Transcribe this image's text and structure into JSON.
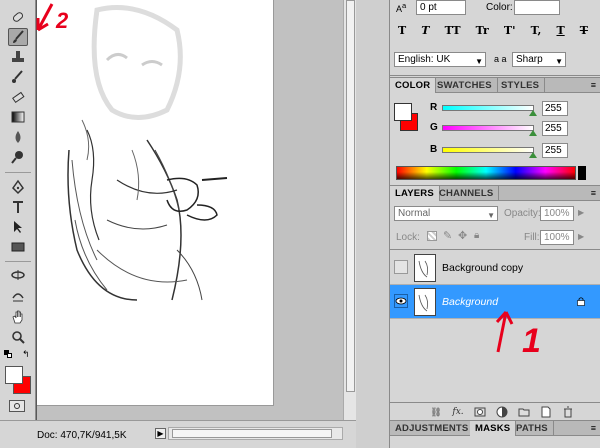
{
  "status_bar": {
    "doc_info": "Doc: 470,7K/941,5K",
    "arrow": "▶"
  },
  "character_panel": {
    "tracking_value": "0 pt",
    "color_label": "Color:",
    "typo_buttons": [
      "T",
      "T",
      "TT",
      "Tr",
      "T'",
      "T,",
      "T",
      "T"
    ],
    "language": "English: UK",
    "antialias_label": "a a",
    "antialias": "Sharp"
  },
  "color_panel": {
    "tabs": [
      "COLOR",
      "SWATCHES",
      "STYLES"
    ],
    "active_tab": "COLOR",
    "foreground_color": "#ffffff",
    "background_color": "#ff0000",
    "channels": [
      {
        "label": "R",
        "value": "255"
      },
      {
        "label": "G",
        "value": "255"
      },
      {
        "label": "B",
        "value": "255"
      }
    ]
  },
  "layers_panel": {
    "tabs": [
      "LAYERS",
      "CHANNELS"
    ],
    "active_tab": "LAYERS",
    "blend_mode": "Normal",
    "opacity_label": "Opacity:",
    "opacity_value": "100%",
    "lock_label": "Lock:",
    "fill_label": "Fill:",
    "fill_value": "100%",
    "layers": [
      {
        "name": "Background copy",
        "visible": false,
        "selected": false,
        "locked": false
      },
      {
        "name": "Background",
        "visible": true,
        "selected": true,
        "locked": true
      }
    ],
    "footer_icons": [
      "link-icon",
      "fx-icon",
      "mask-icon",
      "adjustment-icon",
      "folder-icon",
      "new-layer-icon",
      "trash-icon"
    ],
    "footer_fx": "fx."
  },
  "bottom_tabs": {
    "tabs": [
      "ADJUSTMENTS",
      "MASKS",
      "PATHS"
    ],
    "active_tab": "MASKS"
  },
  "annotations": {
    "label_1": "1",
    "label_2": "2",
    "color": "#e8001c"
  },
  "toolbar": {
    "tools": [
      "spot-healing-icon",
      "brush-icon",
      "clone-stamp-icon",
      "history-brush-icon",
      "eraser-icon",
      "gradient-icon",
      "blur-icon",
      "dodge-icon",
      "pen-icon",
      "type-icon",
      "path-select-icon",
      "rectangle-icon",
      "3d-rotate-icon",
      "3d-orbit-icon",
      "hand-icon",
      "zoom-icon"
    ],
    "active_tool": "brush-icon",
    "foreground": "#ffffff",
    "background": "#ff0000"
  }
}
